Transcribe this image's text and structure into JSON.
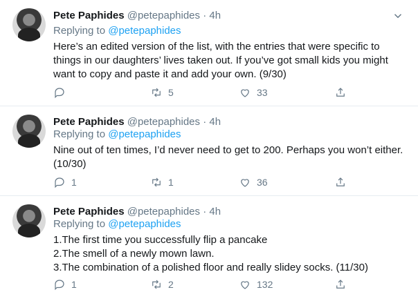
{
  "tweets": [
    {
      "name": "Pete Paphides",
      "handle": "@petepaphides",
      "time": "4h",
      "replying_prefix": "Replying to",
      "replying_to": "@petepaphides",
      "lines": [
        "Here’s an edited version of the list, with the entries that were specific to",
        "things in our daughters’ lives taken out. If you’ve got small kids you might",
        "want to copy and paste it and add your own. (9/30)"
      ],
      "replies": "",
      "retweets": "5",
      "likes": "33"
    },
    {
      "name": "Pete Paphides",
      "handle": "@petepaphides",
      "time": "4h",
      "replying_prefix": "Replying to",
      "replying_to": "@petepaphides",
      "lines": [
        "Nine out of ten times, I’d never need to get to 200. Perhaps you won’t either.",
        "(10/30)"
      ],
      "replies": "1",
      "retweets": "1",
      "likes": "36"
    },
    {
      "name": "Pete Paphides",
      "handle": "@petepaphides",
      "time": "4h",
      "replying_prefix": "Replying to",
      "replying_to": "@petepaphides",
      "lines": [
        "1.The first time you successfully flip a pancake",
        "2.The smell of a newly mown lawn.",
        "3.The combination of a polished floor and really slidey socks. (11/30)"
      ],
      "replies": "1",
      "retweets": "2",
      "likes": "132"
    }
  ],
  "colors": {
    "accent": "#1da1f2",
    "muted": "#657786",
    "text": "#14171a"
  },
  "icons": [
    "reply-icon",
    "retweet-icon",
    "like-icon",
    "share-icon",
    "chevron-down-icon"
  ]
}
